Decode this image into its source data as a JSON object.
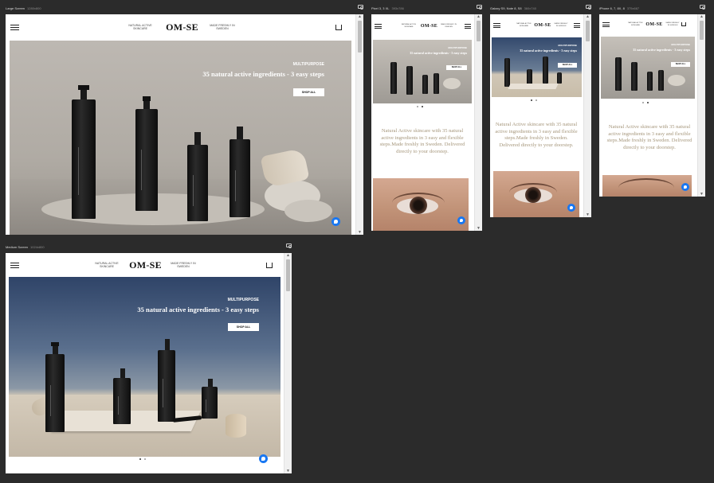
{
  "frames": {
    "large": {
      "name": "Large Screen",
      "size": "1280x800"
    },
    "medium": {
      "name": "Medium Screen",
      "size": "1024x800"
    },
    "pixel": {
      "name": "Pixel 3, 3 XL",
      "size": "393x786"
    },
    "galaxy": {
      "name": "Galaxy S9, Note 8, S8",
      "size": "360x740"
    },
    "iphone": {
      "name": "iPhone 6, 7, 8X, 8",
      "size": "375x667"
    }
  },
  "site": {
    "logo": "OM-SE",
    "tag_left": "NATURAL ACTIVE SKINCARE",
    "tag_right": "MADE FRESHLY IN SWEDEN",
    "hero_category": "MULTIPURPOSE",
    "hero_headline": "35 natural active ingredients - 3 easy steps",
    "shop_button": "SHOP ALL",
    "description": "Natural Active skincare with 35 natural active ingredients in 3 easy and flexible steps.Made freshly in Sweden. Delivered directly to your doorstep."
  },
  "colors": {
    "background": "#2b2b2b",
    "accent_text": "#a6977c",
    "messenger_blue": "#1877f2"
  },
  "icons": [
    "menu-icon",
    "bag-icon",
    "messenger-icon",
    "camera-icon"
  ]
}
